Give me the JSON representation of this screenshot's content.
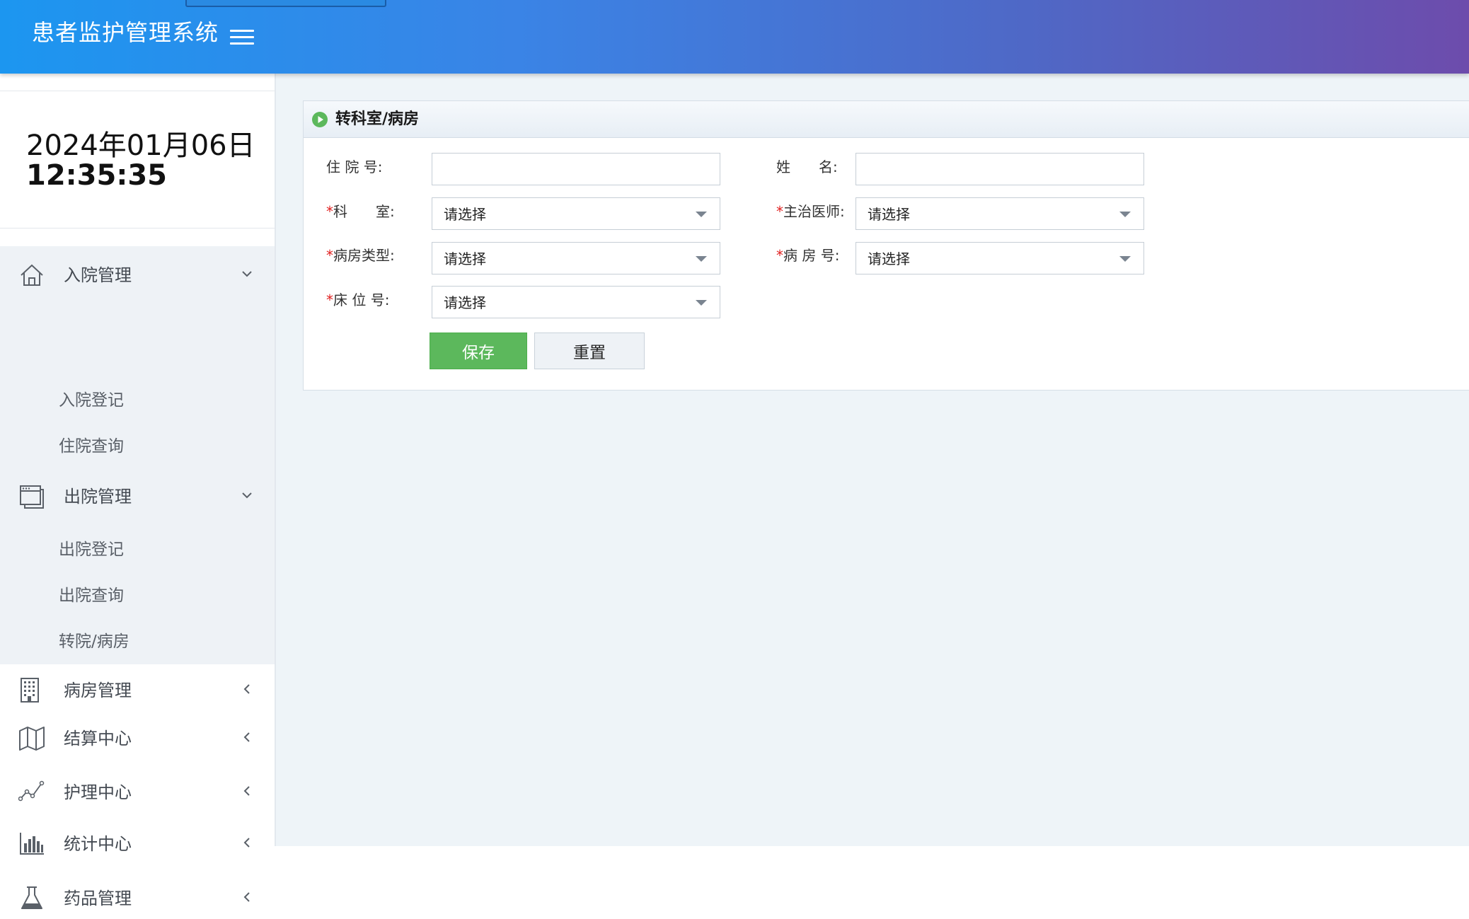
{
  "app": {
    "title": "患者监护管理系统"
  },
  "sidebar": {
    "clock": {
      "date": "2024年01月06日",
      "time": "12:35:35"
    },
    "menu": [
      {
        "label": "入院管理",
        "icon": "home-icon",
        "expanded": true,
        "children": [
          {
            "label": "入院登记"
          },
          {
            "label": "住院查询"
          }
        ]
      },
      {
        "label": "出院管理",
        "icon": "window-icon",
        "expanded": true,
        "children": [
          {
            "label": "出院登记"
          },
          {
            "label": "出院查询"
          },
          {
            "label": "转院/病房"
          }
        ]
      },
      {
        "label": "病房管理",
        "icon": "building-icon",
        "expanded": false
      },
      {
        "label": "结算中心",
        "icon": "map-icon",
        "expanded": false
      },
      {
        "label": "护理中心",
        "icon": "line-chart-icon",
        "expanded": false
      },
      {
        "label": "统计中心",
        "icon": "bar-chart-icon",
        "expanded": false
      },
      {
        "label": "药品管理",
        "icon": "flask-icon",
        "expanded": false
      }
    ]
  },
  "panel": {
    "title": "转科室/病房",
    "required_mark": "*",
    "fields": {
      "admission_no": {
        "label": "住 院 号:",
        "value": ""
      },
      "name": {
        "label": "姓　　名:",
        "value": ""
      },
      "department": {
        "label": "科　　室:",
        "value": "请选择",
        "required": true
      },
      "doctor": {
        "label": "主治医师:",
        "value": "请选择",
        "required": true
      },
      "ward_type": {
        "label": "病房类型:",
        "value": "请选择",
        "required": true
      },
      "ward_no": {
        "label": "病 房 号:",
        "value": "请选择",
        "required": true
      },
      "bed_no": {
        "label": "床 位 号:",
        "value": "请选择",
        "required": true
      }
    },
    "buttons": {
      "save": "保存",
      "reset": "重置"
    }
  },
  "colors": {
    "header_gradient_start": "#1c96f0",
    "header_gradient_end": "#6d4cac",
    "save_button": "#5cb85c",
    "required": "#e02020",
    "panel_icon": "#5cb85c"
  }
}
